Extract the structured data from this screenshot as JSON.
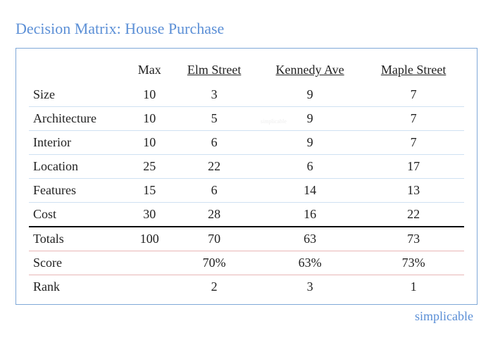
{
  "title": "Decision Matrix: House Purchase",
  "attribution": "simplicable",
  "watermark": "simplicable",
  "headers": {
    "max": "Max",
    "options": [
      "Elm Street",
      "Kennedy Ave",
      "Maple Street"
    ]
  },
  "criteria": [
    {
      "name": "Size",
      "max": "10",
      "values": [
        "3",
        "9",
        "7"
      ]
    },
    {
      "name": "Architecture",
      "max": "10",
      "values": [
        "5",
        "9",
        "7"
      ]
    },
    {
      "name": "Interior",
      "max": "10",
      "values": [
        "6",
        "9",
        "7"
      ]
    },
    {
      "name": "Location",
      "max": "25",
      "values": [
        "22",
        "6",
        "17"
      ]
    },
    {
      "name": "Features",
      "max": "15",
      "values": [
        "6",
        "14",
        "13"
      ]
    },
    {
      "name": "Cost",
      "max": "30",
      "values": [
        "28",
        "16",
        "22"
      ]
    }
  ],
  "totals": {
    "label": "Totals",
    "max": "100",
    "values": [
      "70",
      "63",
      "73"
    ]
  },
  "score": {
    "label": "Score",
    "max": "",
    "values": [
      "70%",
      "63%",
      "73%"
    ]
  },
  "rank": {
    "label": "Rank",
    "max": "",
    "values": [
      "2",
      "3",
      "1"
    ]
  },
  "chart_data": {
    "type": "table",
    "title": "Decision Matrix: House Purchase",
    "categories": [
      "Size",
      "Architecture",
      "Interior",
      "Location",
      "Features",
      "Cost"
    ],
    "max": [
      10,
      10,
      10,
      25,
      15,
      30
    ],
    "series": [
      {
        "name": "Elm Street",
        "values": [
          3,
          5,
          6,
          22,
          6,
          28
        ],
        "total": 70,
        "score_pct": 70,
        "rank": 2
      },
      {
        "name": "Kennedy Ave",
        "values": [
          9,
          9,
          9,
          6,
          14,
          16
        ],
        "total": 63,
        "score_pct": 63,
        "rank": 3
      },
      {
        "name": "Maple Street",
        "values": [
          7,
          7,
          7,
          17,
          13,
          22
        ],
        "total": 73,
        "score_pct": 73,
        "rank": 1
      }
    ],
    "totals_max": 100
  }
}
